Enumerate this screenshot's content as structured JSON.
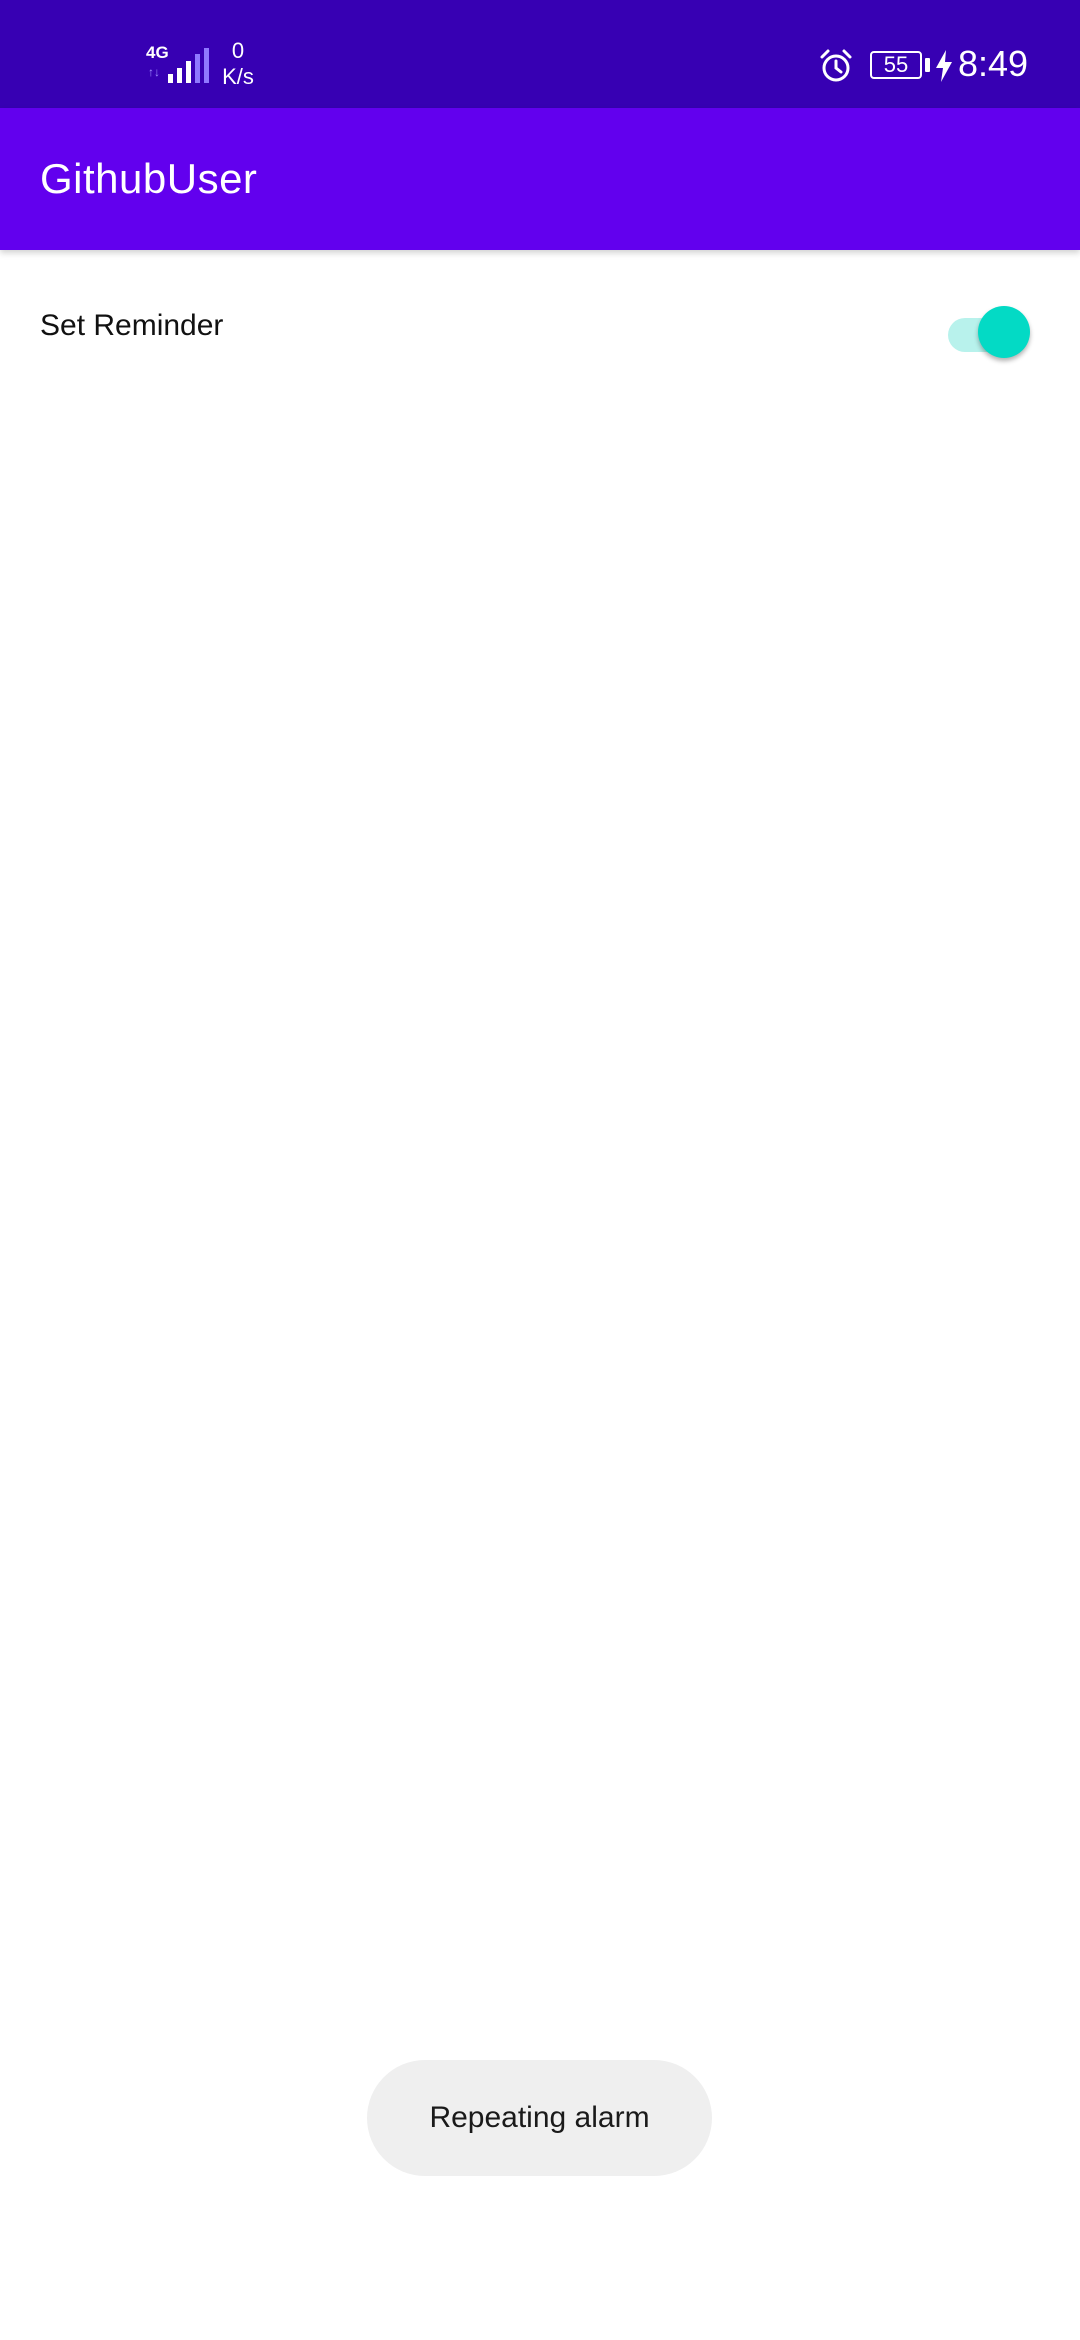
{
  "status_bar": {
    "network_type": "4G",
    "network_arrows": "↑↓",
    "speed_value": "0",
    "speed_unit": "K/s",
    "battery_level": "55",
    "time": "8:49",
    "background": "#3700B3",
    "icons": [
      "signal-icon",
      "alarm-icon",
      "battery-icon",
      "charging-bolt-icon"
    ]
  },
  "app_bar": {
    "title": "GithubUser",
    "background": "#6200EE"
  },
  "settings": {
    "reminder": {
      "label": "Set Reminder",
      "enabled": true,
      "thumb_color": "#03DAC5",
      "track_color": "#B8F2EC"
    }
  },
  "toast": {
    "message": "Repeating alarm"
  }
}
